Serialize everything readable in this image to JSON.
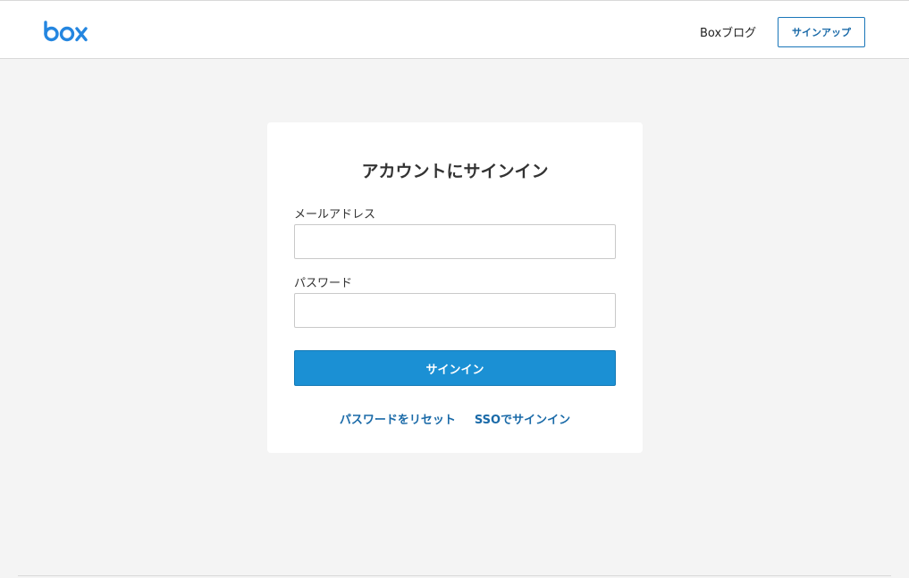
{
  "header": {
    "logo_text": "box",
    "blog_link": "Boxブログ",
    "signup_button": "サインアップ"
  },
  "login": {
    "title": "アカウントにサインイン",
    "email_label": "メールアドレス",
    "email_value": "",
    "password_label": "パスワード",
    "password_value": "",
    "submit_button": "サインイン",
    "reset_password_link": "パスワードをリセット",
    "sso_link": "SSOでサインイン"
  },
  "colors": {
    "brand_blue": "#2486e0",
    "button_blue": "#1b90d4",
    "link_blue": "#1a6aa8",
    "page_background": "#f4f4f4"
  }
}
